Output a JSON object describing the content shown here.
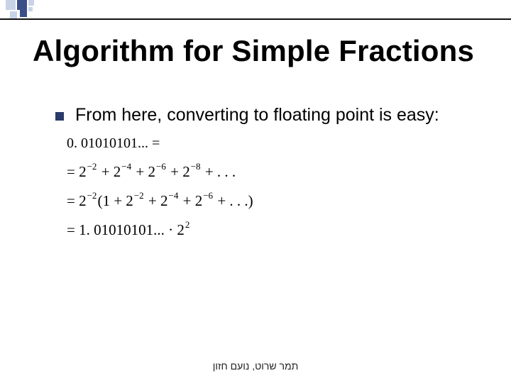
{
  "slide": {
    "title": "Algorithm for Simple Fractions",
    "bullet": "From here, converting to floating point is easy:",
    "math": {
      "line1_lhs": "0. 01010101... =",
      "line2_eq": "=",
      "line2_t1b": "2",
      "line2_t1e": "−2",
      "line2_p1": " + ",
      "line2_t2b": "2",
      "line2_t2e": "−4",
      "line2_p2": " + ",
      "line2_t3b": "2",
      "line2_t3e": "−6",
      "line2_p3": " + ",
      "line2_t4b": "2",
      "line2_t4e": "−8",
      "line2_tail": " + . . .",
      "line3_eq": "=",
      "line3_fb": "2",
      "line3_fe": "−2",
      "line3_open": "(1 + ",
      "line3_t1b": "2",
      "line3_t1e": "−2",
      "line3_p1": " + ",
      "line3_t2b": "2",
      "line3_t2e": "−4",
      "line3_p2": " + ",
      "line3_t3b": "2",
      "line3_t3e": "−6",
      "line3_close": " + . . .)",
      "line4_eq": "=",
      "line4_main": "1. 01010101... · 2",
      "line4_exp": "2"
    },
    "footer": "תמר שרוט, נועם חזון"
  }
}
